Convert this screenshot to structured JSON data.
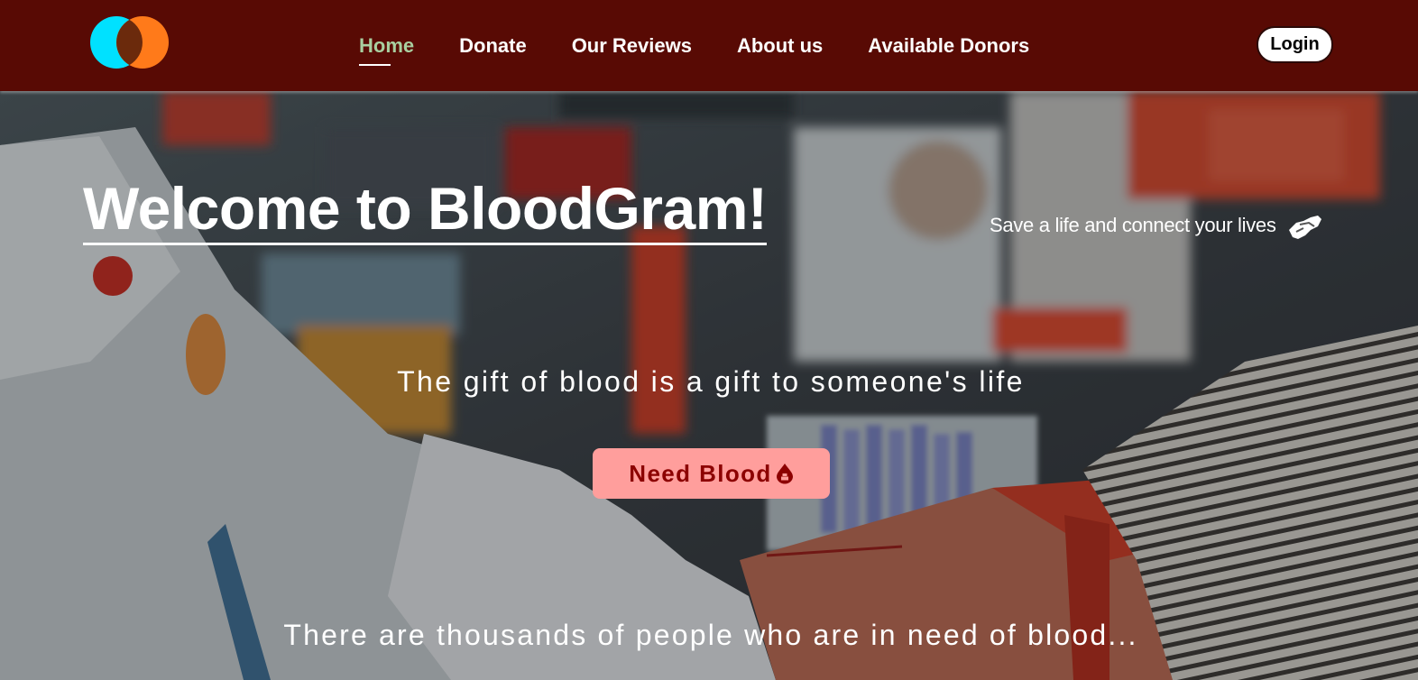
{
  "brand": {
    "logo_icon": "overlapping-circles-logo",
    "colors": {
      "cyan": "#00e1ff",
      "orange": "#ff7a1a",
      "overlap": "#6b2a0c"
    }
  },
  "nav": {
    "background": "#580a04",
    "links": [
      "Home",
      "Donate",
      "Our Reviews",
      "About us",
      "Available Donors"
    ],
    "active_link": "Home",
    "active_color": "#a9cfa0",
    "login_label": "Login"
  },
  "hero": {
    "background_image": "blood-donation-photo",
    "title": "Welcome to BloodGram!",
    "tagline": "Save a life and connect your lives",
    "tagline_icon": "handshake-icon",
    "gift_text": "The gift of blood is a gift to someone's life",
    "cta_label": "Need Blood",
    "cta_icon": "blood-drop-icon",
    "cta_colors": {
      "background": "#ff9e9c",
      "text": "#8c0000"
    },
    "footer_text": "There are thousands of people who are in need of blood..."
  }
}
